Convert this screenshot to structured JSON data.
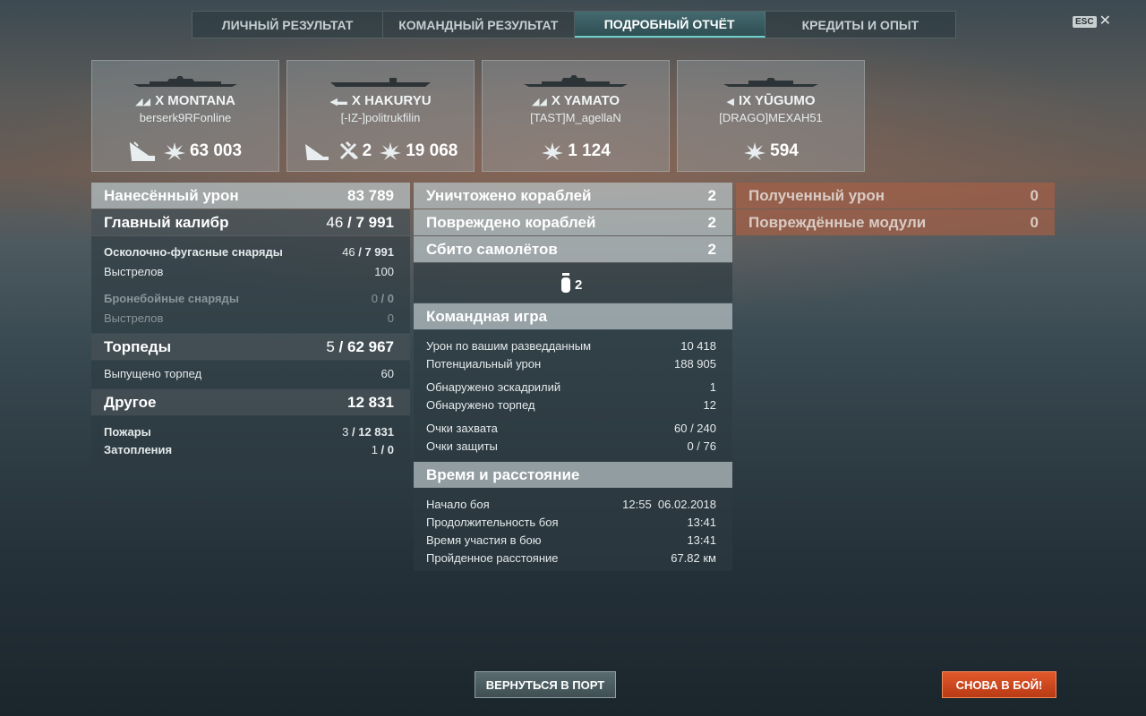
{
  "tabs": [
    {
      "label": "ЛИЧНЫЙ РЕЗУЛЬТАТ"
    },
    {
      "label": "КОМАНДНЫЙ РЕЗУЛЬТАТ"
    },
    {
      "label": "ПОДРОБНЫЙ ОТЧЁТ",
      "active": true
    },
    {
      "label": "КРЕДИТЫ И ОПЫТ"
    }
  ],
  "esc": {
    "key": "ESC",
    "close": "✕"
  },
  "ships": [
    {
      "tier": "X",
      "name": "MONTANA",
      "player": "berserk9RFonline",
      "nation_icon": "usa-flag-icon",
      "sunk": true,
      "kills": "",
      "damage": "63 003"
    },
    {
      "tier": "X",
      "name": "HAKURYU",
      "player": "[-IZ-]politrukfilin",
      "nation_icon": "japan-flag-icon",
      "sunk": true,
      "planes": "2",
      "damage": "19 068"
    },
    {
      "tier": "X",
      "name": "YAMATO",
      "player": "[TAST]M_agellaN",
      "nation_icon": "japan-flag-icon",
      "sunk": false,
      "damage": "1 124"
    },
    {
      "tier": "IX",
      "name": "YŪGUMO",
      "player": "[DRAGO]MEXAH51",
      "nation_icon": "japan-flag-icon",
      "sunk": false,
      "damage": "594"
    }
  ],
  "damage": {
    "title": "Нанесённый урон",
    "total": "83 789",
    "main_battery": {
      "label": "Главный калибр",
      "hits": "46",
      "value": "7 991"
    },
    "he": {
      "label": "Осколочно-фугасные снаряды",
      "hits": "46",
      "value": "7 991"
    },
    "he_shots": {
      "label": "Выстрелов",
      "value": "100"
    },
    "ap": {
      "label": "Бронебойные снаряды",
      "hits": "0",
      "value": "0"
    },
    "ap_shots": {
      "label": "Выстрелов",
      "value": "0"
    },
    "torpedoes": {
      "label": "Торпеды",
      "hits": "5",
      "value": "62 967"
    },
    "torps_launched": {
      "label": "Выпущено торпед",
      "value": "60"
    },
    "other": {
      "label": "Другое",
      "value": "12 831"
    },
    "fires": {
      "label": "Пожары",
      "hits": "3",
      "value": "12 831"
    },
    "floods": {
      "label": "Затопления",
      "hits": "1",
      "value": "0"
    }
  },
  "kills": {
    "destroyed": {
      "label": "Уничтожено кораблей",
      "value": "2"
    },
    "damaged": {
      "label": "Повреждено кораблей",
      "value": "2"
    },
    "planes": {
      "label": "Сбито самолётов",
      "value": "2"
    },
    "plane_type_count": "2"
  },
  "team": {
    "title": "Командная игра",
    "rows": [
      {
        "label": "Урон по вашим разведданным",
        "value": "10 418"
      },
      {
        "label": "Потенциальный урон",
        "value": "188 905"
      },
      {
        "label": "Обнаружено эскадрилий",
        "value": "1"
      },
      {
        "label": "Обнаружено торпед",
        "value": "12"
      },
      {
        "label": "Очки захвата",
        "value": "60 / 240"
      },
      {
        "label": "Очки защиты",
        "value": "0 / 76"
      }
    ]
  },
  "time": {
    "title": "Время и расстояние",
    "rows": [
      {
        "label": "Начало боя",
        "value": "12:55  06.02.2018"
      },
      {
        "label": "Продолжительность боя",
        "value": "13:41"
      },
      {
        "label": "Время участия в бою",
        "value": "13:41"
      },
      {
        "label": "Пройденное расстояние",
        "value": "67.82 км"
      }
    ]
  },
  "received": {
    "damage": {
      "label": "Полученный урон",
      "value": "0"
    },
    "modules": {
      "label": "Повреждённые модули",
      "value": "0"
    }
  },
  "buttons": {
    "port": "ВЕРНУТЬСЯ В ПОРТ",
    "battle": "СНОВА В БОЙ!"
  }
}
